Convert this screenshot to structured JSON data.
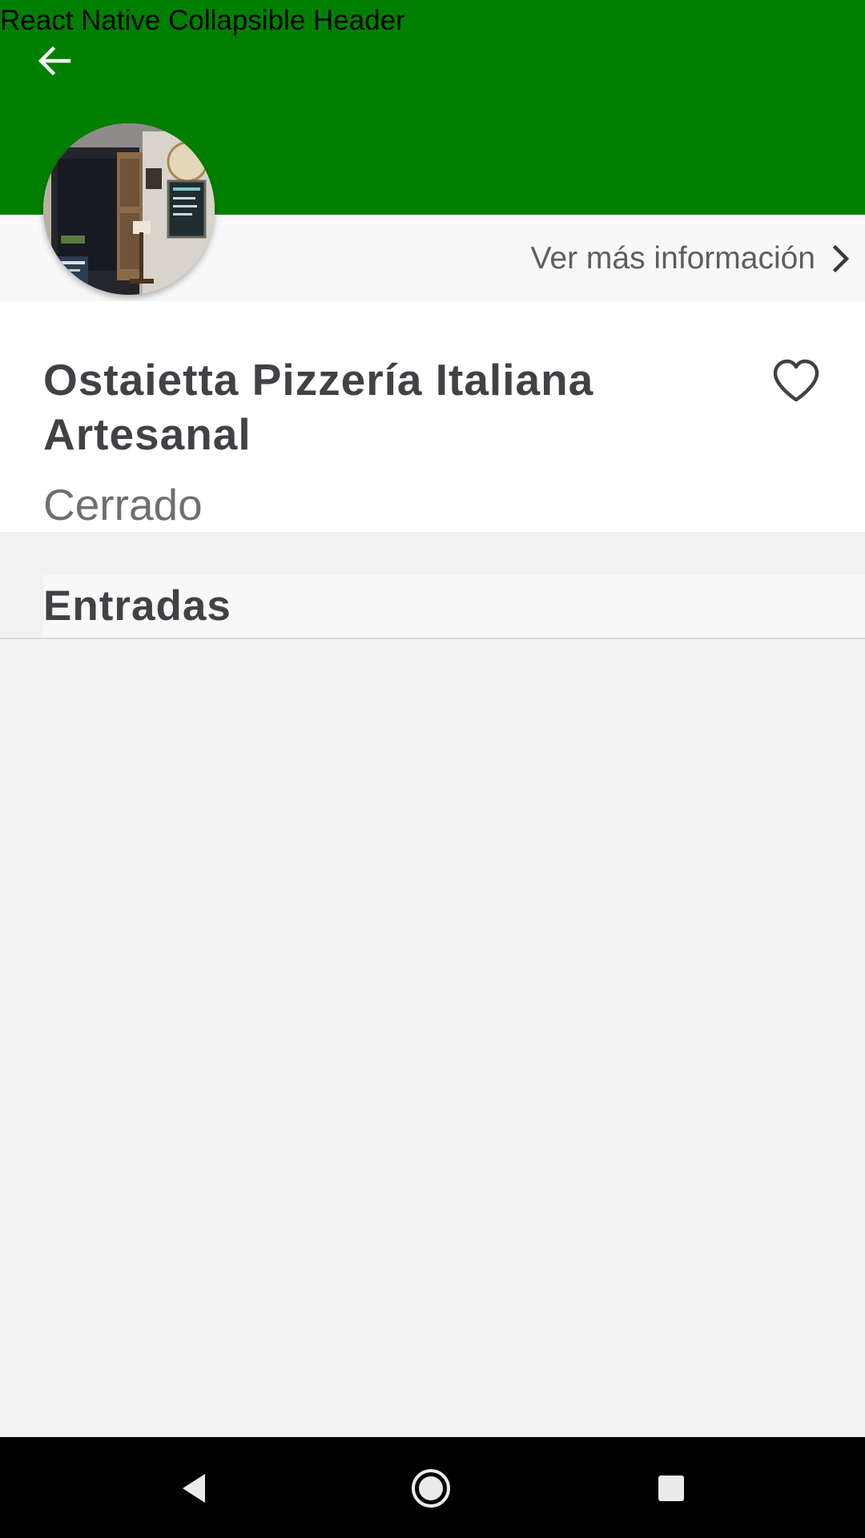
{
  "app": {
    "title": "React Native Collapsible Header"
  },
  "header": {
    "background_color": "#008000",
    "back_icon": "arrow-left-icon",
    "more_info_label": "Ver más información",
    "more_info_icon": "chevron-right-icon"
  },
  "restaurant": {
    "name": "Ostaietta Pizzería Italiana Artesanal",
    "status": "Cerrado",
    "favorite_icon": "heart-outline-icon",
    "avatar": "restaurant-storefront-photo"
  },
  "menu": {
    "sections": [
      {
        "title": "Entradas"
      }
    ]
  },
  "system_nav": {
    "back_icon": "triangle-back-icon",
    "home_icon": "circle-home-icon",
    "recents_icon": "square-recents-icon"
  }
}
